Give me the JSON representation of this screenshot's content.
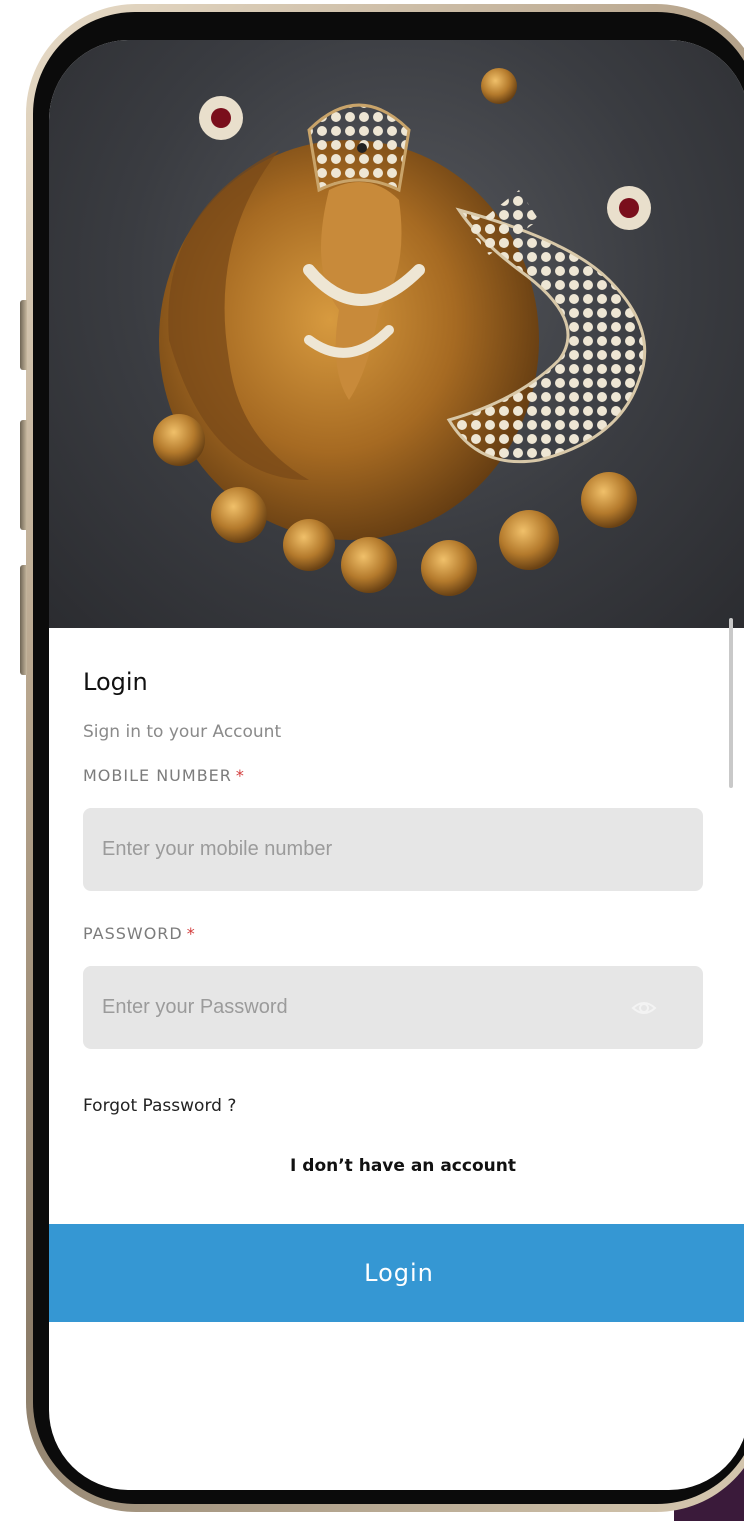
{
  "login_form": {
    "title": "Login",
    "subtitle": "Sign in to your Account",
    "mobile": {
      "label": "MOBILE NUMBER",
      "required_mark": "*",
      "placeholder": "Enter your mobile number",
      "value": ""
    },
    "password": {
      "label": "PASSWORD",
      "required_mark": "*",
      "placeholder": "Enter your Password",
      "value": "",
      "toggle_icon": "eye-icon"
    },
    "forgot_password": "Forgot Password ?",
    "no_account": "I don’t have an account",
    "submit_label": "Login"
  },
  "hero_image": {
    "subject": "gold-ganesha-pendant",
    "icon": "pendant-image"
  },
  "colors": {
    "accent": "#3597d3",
    "required": "#d23a3a",
    "input_bg": "#e6e6e6",
    "hero_bg": "#3a3c41"
  }
}
